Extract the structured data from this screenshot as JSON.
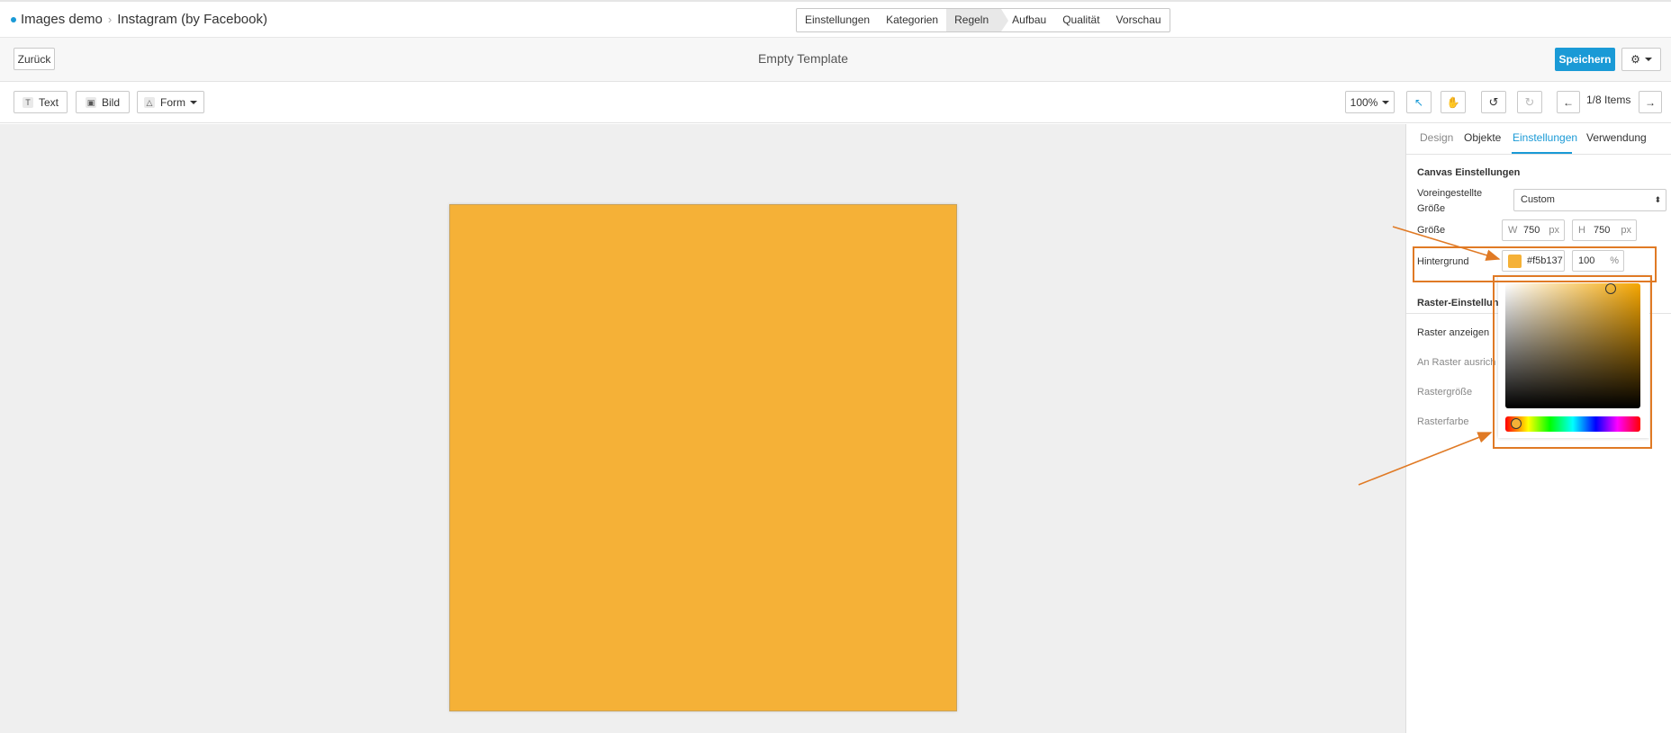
{
  "breadcrumb": {
    "items": [
      "Images demo",
      "Instagram (by Facebook)"
    ]
  },
  "steps": [
    "Einstellungen",
    "Kategorien",
    "Regeln",
    "Aufbau",
    "Qualität",
    "Vorschau"
  ],
  "active_step": "Regeln",
  "header": {
    "back_label": "Zurück",
    "title": "Empty Template",
    "save_label": "Speichern"
  },
  "toolbar": {
    "text_label": "Text",
    "image_label": "Bild",
    "shape_label": "Form",
    "zoom": "100%",
    "items_label": "1/8 Items"
  },
  "panel": {
    "tabs": [
      "Design",
      "Objekte",
      "Einstellungen",
      "Verwendung"
    ],
    "active_tab": "Einstellungen",
    "canvas_section_title": "Canvas Einstellungen",
    "preset_label_line1": "Voreingestellte",
    "preset_label_line2": "Größe",
    "preset_value": "Custom",
    "size_label": "Größe",
    "width_prefix": "W",
    "width_value": "750",
    "width_unit": "px",
    "height_prefix": "H",
    "height_value": "750",
    "height_unit": "px",
    "background_label": "Hintergrund",
    "background_hex": "#f5b137",
    "background_opacity": "100",
    "opacity_unit": "%",
    "grid_section_title": "Raster-Einstellung",
    "grid_show_label": "Raster anzeigen",
    "grid_snap_label": "An Raster ausrich",
    "grid_size_label": "Rastergröße",
    "grid_color_label": "Rasterfarbe"
  },
  "colors": {
    "canvas": "#f5b137",
    "accent": "#1a9ad6",
    "annotation": "#e07a25"
  }
}
